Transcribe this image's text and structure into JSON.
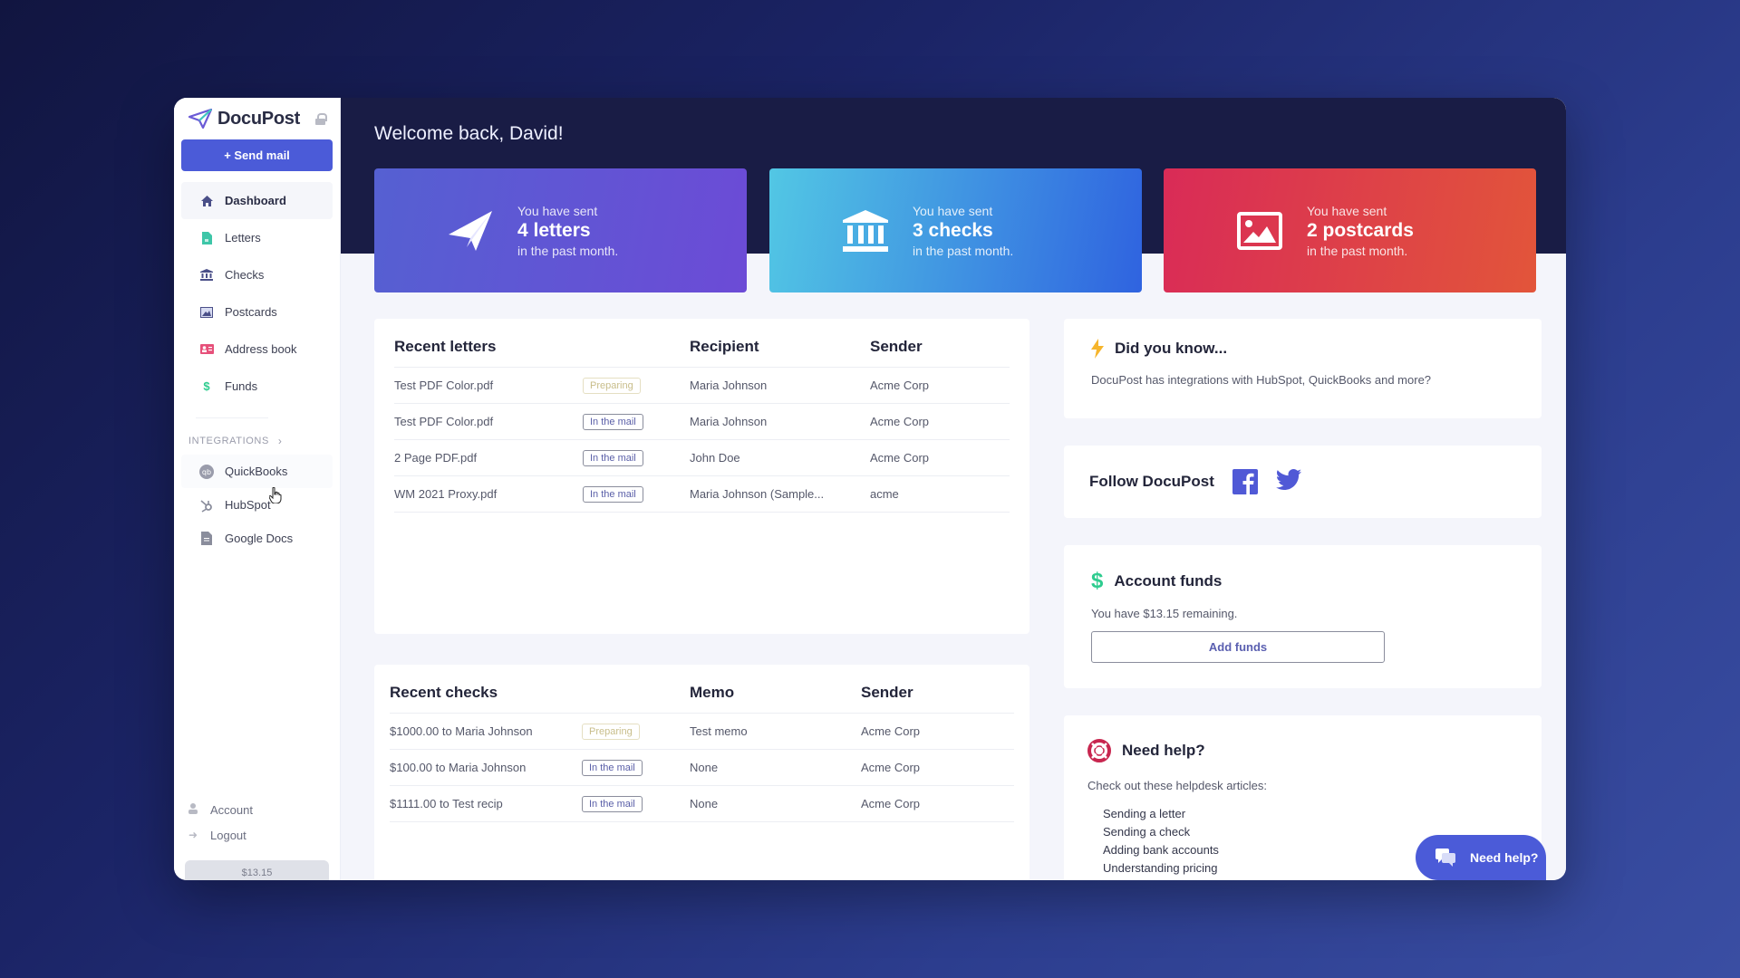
{
  "brand": {
    "name": "DocuPost"
  },
  "sidebar": {
    "send_mail_label": "+ Send mail",
    "nav": [
      {
        "label": "Dashboard",
        "icon": "home-icon",
        "active": true
      },
      {
        "label": "Letters",
        "icon": "document-icon"
      },
      {
        "label": "Checks",
        "icon": "bank-icon"
      },
      {
        "label": "Postcards",
        "icon": "image-icon"
      },
      {
        "label": "Address book",
        "icon": "address-card-icon"
      },
      {
        "label": "Funds",
        "icon": "dollar-icon"
      }
    ],
    "integrations_label": "INTEGRATIONS",
    "integrations": [
      {
        "label": "QuickBooks",
        "icon": "quickbooks-icon"
      },
      {
        "label": "HubSpot",
        "icon": "hubspot-icon"
      },
      {
        "label": "Google Docs",
        "icon": "google-docs-icon"
      }
    ],
    "bottom": [
      {
        "label": "Account",
        "icon": "user-icon"
      },
      {
        "label": "Logout",
        "icon": "logout-icon"
      }
    ],
    "balance": "$13.15"
  },
  "main": {
    "welcome": "Welcome back, David!",
    "stats": [
      {
        "pre": "You have sent",
        "value": "4 letters",
        "post": "in the past month.",
        "icon": "paper-plane-icon"
      },
      {
        "pre": "You have sent",
        "value": "3 checks",
        "post": "in the past month.",
        "icon": "bank-icon"
      },
      {
        "pre": "You have sent",
        "value": "2 postcards",
        "post": "in the past month.",
        "icon": "image-icon"
      }
    ],
    "recent_letters": {
      "columns": [
        "Recent letters",
        "",
        "Recipient",
        "Sender"
      ],
      "rows": [
        {
          "name": "Test PDF Color.pdf",
          "status": "Preparing",
          "recipient": "Maria Johnson",
          "sender": "Acme Corp"
        },
        {
          "name": "Test PDF Color.pdf",
          "status": "In the mail",
          "recipient": "Maria Johnson",
          "sender": "Acme Corp"
        },
        {
          "name": "2 Page PDF.pdf",
          "status": "In the mail",
          "recipient": "John Doe",
          "sender": "Acme Corp"
        },
        {
          "name": "WM 2021 Proxy.pdf",
          "status": "In the mail",
          "recipient": "Maria Johnson (Sample...",
          "sender": "acme"
        }
      ]
    },
    "recent_checks": {
      "columns": [
        "Recent checks",
        "",
        "Memo",
        "Sender"
      ],
      "rows": [
        {
          "name": "$1000.00 to Maria Johnson",
          "status": "Preparing",
          "memo": "Test memo",
          "sender": "Acme Corp"
        },
        {
          "name": "$100.00 to Maria Johnson",
          "status": "In the mail",
          "memo": "None",
          "sender": "Acme Corp"
        },
        {
          "name": "$1111.00 to Test recip",
          "status": "In the mail",
          "memo": "None",
          "sender": "Acme Corp"
        }
      ]
    }
  },
  "right": {
    "did_you_know": {
      "title": "Did you know...",
      "text": "DocuPost has integrations with HubSpot, QuickBooks and more?"
    },
    "follow": {
      "title": "Follow DocuPost"
    },
    "funds": {
      "title": "Account funds",
      "text": "You have $13.15 remaining.",
      "button": "Add funds"
    },
    "help": {
      "title": "Need help?",
      "text": "Check out these helpdesk articles:",
      "articles": [
        "Sending a letter",
        "Sending a check",
        "Adding bank accounts",
        "Understanding pricing"
      ]
    },
    "chat_button": "Need help?"
  },
  "colors": {
    "accent": "#4b5bd8",
    "dark_header": "#191c45",
    "funds_green": "#2ecc8f",
    "help_red": "#c8264f",
    "bolt_yellow": "#f6b52c"
  }
}
